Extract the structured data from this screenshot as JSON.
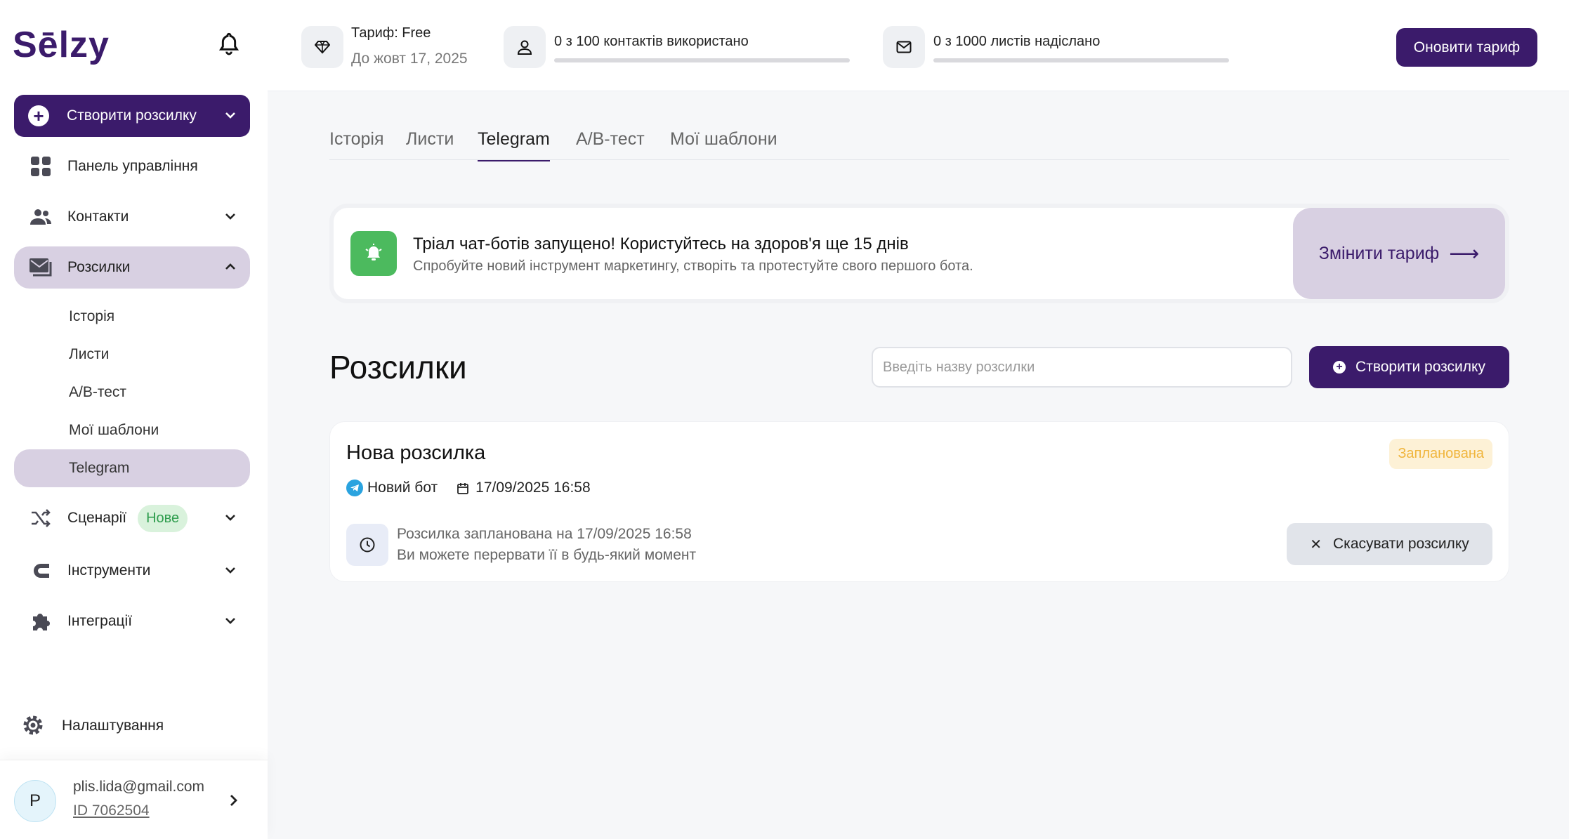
{
  "brand": {
    "logo": "Sēlzy",
    "accent": "#3b1b6b"
  },
  "sidebar": {
    "create_button": "Створити розсилку",
    "items": [
      {
        "label": "Панель управління",
        "icon": "grid-icon"
      },
      {
        "label": "Контакти",
        "icon": "users-icon"
      },
      {
        "label": "Розсилки",
        "icon": "mailings-icon"
      },
      {
        "label": "Сценарії",
        "icon": "shuffle-icon",
        "badge": "Нове"
      },
      {
        "label": "Інструменти",
        "icon": "magnet-icon"
      },
      {
        "label": "Інтеграції",
        "icon": "puzzle-icon"
      }
    ],
    "sub_items": [
      "Історія",
      "Листи",
      "A/B-тест",
      "Мої шаблони",
      "Telegram"
    ],
    "settings": "Налаштування",
    "user": {
      "avatar": "P",
      "email": "plis.lida@gmail.com",
      "id": "ID 7062504"
    }
  },
  "topbar": {
    "plan": "Тариф: Free",
    "plan_until": "До жовт 17, 2025",
    "contacts": "0 з 100 контактів використано",
    "emails": "0 з 1000 листів надіслано",
    "upgrade": "Оновити тариф"
  },
  "tabs": [
    {
      "label": "Історія",
      "active": false
    },
    {
      "label": "Листи",
      "active": false
    },
    {
      "label": "Telegram",
      "active": true
    },
    {
      "label": "A/B-тест",
      "active": false
    },
    {
      "label": "Мої шаблони",
      "active": false
    }
  ],
  "promo": {
    "title": "Тріал чат-ботів запущено! Користуйтесь на здоров'я ще 15 днів",
    "subtitle": "Спробуйте новий інструмент маркетингу, створіть та протестуйте свого першого бота.",
    "button": "Змінити тариф",
    "arrow": "⟶"
  },
  "main": {
    "title": "Розсилки",
    "search_placeholder": "Введіть назву розсилки",
    "create_button": "Створити розсилку"
  },
  "campaign": {
    "title": "Нова розсилка",
    "status": "Запланована",
    "bot": "Новий бот",
    "datetime": "17/09/2025 16:58",
    "scheduled_line": "Розсилка запланована на 17/09/2025 16:58",
    "hint": "Ви можете перервати її в будь-який момент",
    "cancel_button": "Скасувати розсилку"
  }
}
